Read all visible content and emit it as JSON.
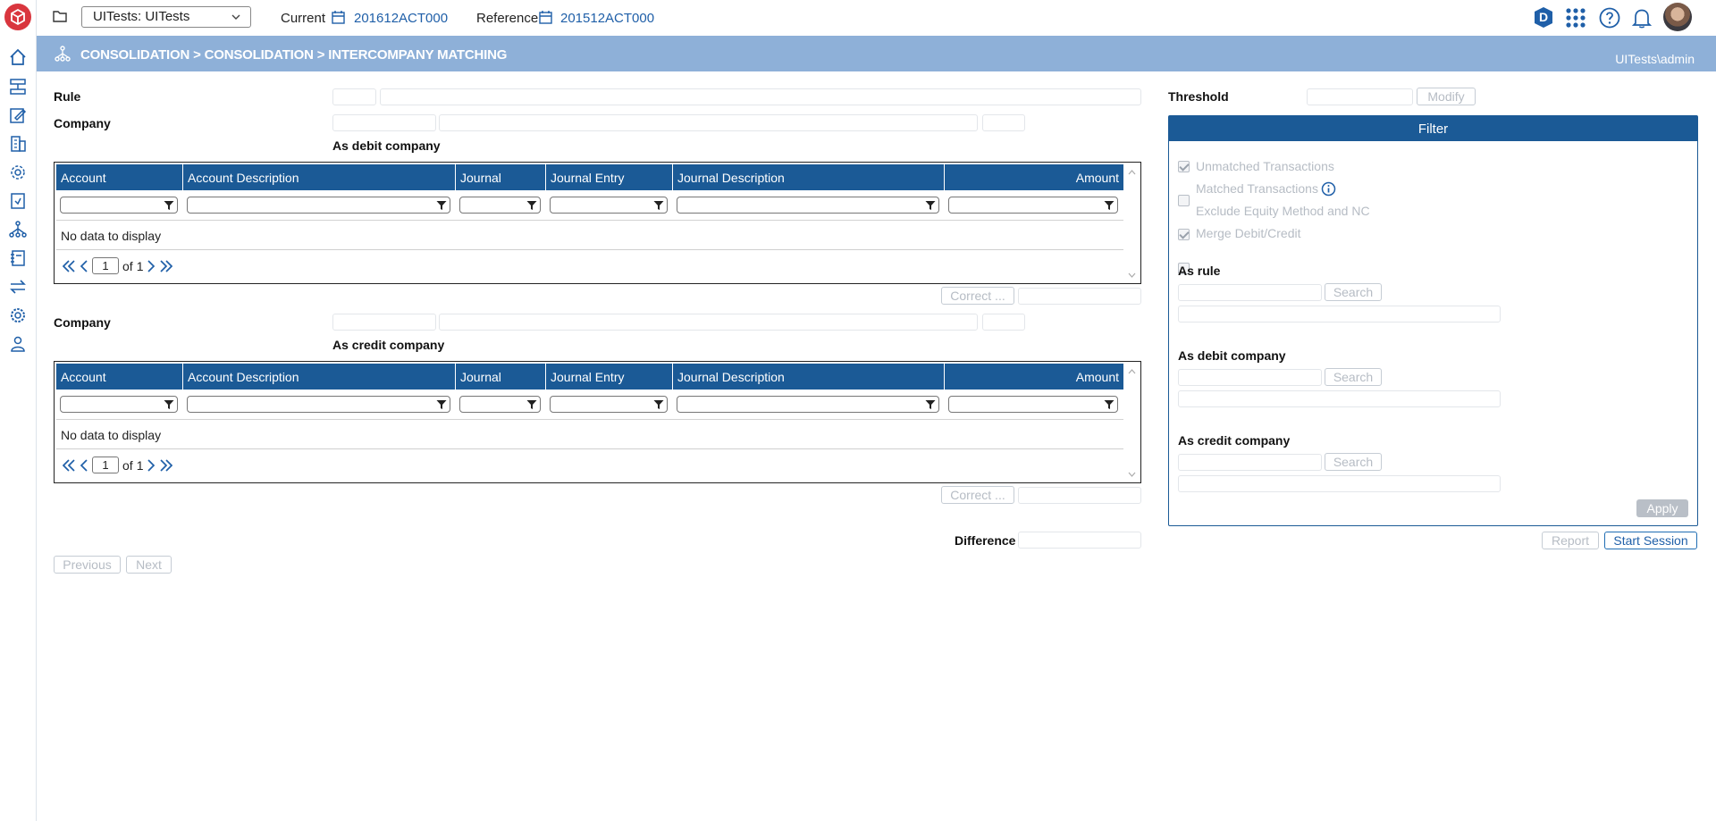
{
  "topbar": {
    "dataset": "UITests: UITests",
    "current_label": "Current",
    "current_value": "201612ACT000",
    "reference_label": "Reference",
    "reference_value": "201512ACT000",
    "user_badge": "D"
  },
  "band": {
    "breadcrumb": "CONSOLIDATION > CONSOLIDATION > INTERCOMPANY MATCHING",
    "user": "UITests\\admin"
  },
  "form": {
    "rule_label": "Rule",
    "company_label": "Company",
    "as_debit_label": "As debit company",
    "as_credit_label": "As credit company",
    "threshold_label": "Threshold",
    "modify_button": "Modify",
    "correct_button": "Correct ...",
    "difference_label": "Difference",
    "previous_button": "Previous",
    "next_button": "Next",
    "report_button": "Report",
    "start_session_button": "Start Session"
  },
  "grid": {
    "columns": [
      "Account",
      "Account Description",
      "Journal",
      "Journal Entry",
      "Journal Description",
      "Amount"
    ],
    "empty_text": "No data to display",
    "page": "1",
    "of_label": "of",
    "total_pages": "1"
  },
  "filter": {
    "title": "Filter",
    "options": [
      {
        "label": "Unmatched Transactions",
        "checked": true
      },
      {
        "label": "Matched Transactions",
        "checked": false
      },
      {
        "label": "Exclude Equity Method and NC",
        "checked": true
      },
      {
        "label": "Merge Debit/Credit",
        "checked": false
      }
    ],
    "as_rule_label": "As rule",
    "as_debit_label": "As debit company",
    "as_credit_label": "As credit company",
    "search_button": "Search",
    "apply_button": "Apply"
  },
  "colors": {
    "brand": "#d9363e",
    "header_band": "#8eb0d8",
    "grid_header": "#1b5a96",
    "link": "#1f5fa8"
  }
}
